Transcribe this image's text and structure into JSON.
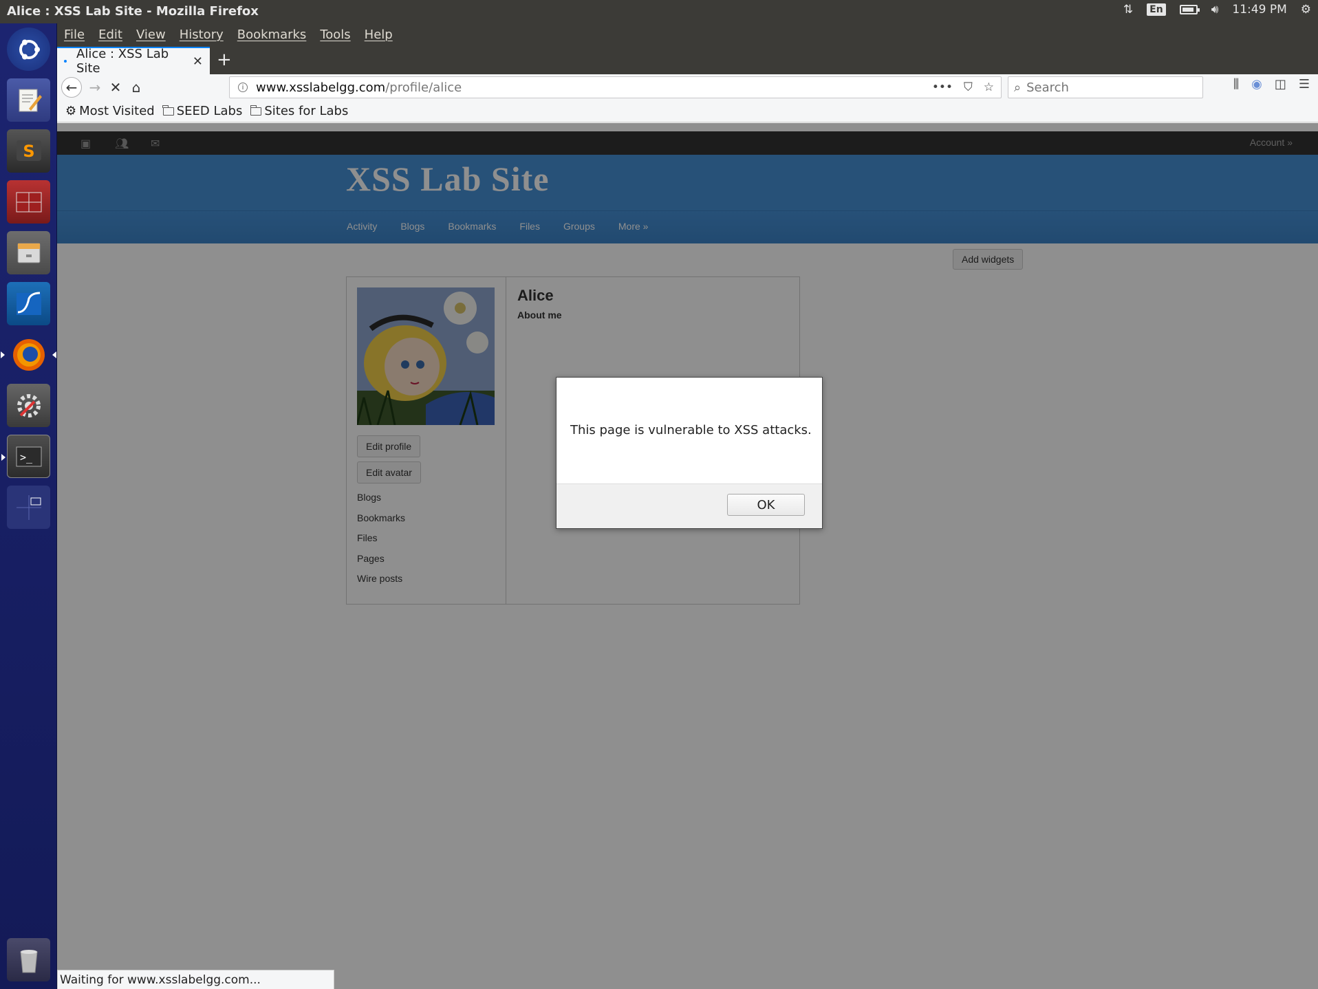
{
  "os": {
    "window_title": "Alice : XSS Lab Site - Mozilla Firefox",
    "keyboard_lang": "En",
    "clock": "11:49 PM",
    "launcher": [
      "ubuntu-dash",
      "text-editor",
      "sublime-text",
      "terminator",
      "file-manager",
      "wireshark",
      "firefox",
      "system-settings",
      "terminal",
      "workspace-switcher",
      "trash"
    ]
  },
  "menubar": [
    "File",
    "Edit",
    "View",
    "History",
    "Bookmarks",
    "Tools",
    "Help"
  ],
  "tab": {
    "label": "Alice : XSS Lab Site"
  },
  "urlbar": {
    "host": "www.xsslabelgg.com",
    "path": "/profile/alice"
  },
  "search": {
    "placeholder": "Search"
  },
  "bookmarks": [
    "Most Visited",
    "SEED Labs",
    "Sites for Labs"
  ],
  "site": {
    "account": "Account »",
    "title": "XSS Lab Site",
    "nav": [
      "Activity",
      "Blogs",
      "Bookmarks",
      "Files",
      "Groups",
      "More »"
    ],
    "add_widgets": "Add widgets"
  },
  "profile": {
    "name": "Alice",
    "about": "About me",
    "edit_profile": "Edit profile",
    "edit_avatar": "Edit avatar",
    "links": [
      "Blogs",
      "Bookmarks",
      "Files",
      "Pages",
      "Wire posts"
    ]
  },
  "dialog": {
    "message": "This page is vulnerable to XSS attacks.",
    "ok": "OK"
  },
  "status": "Waiting for www.xsslabelgg.com..."
}
